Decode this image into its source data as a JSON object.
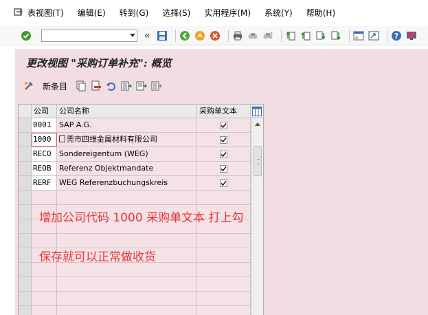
{
  "menubar": {
    "items": [
      "表视图(T)",
      "编辑(E)",
      "转到(G)",
      "选择(S)",
      "实用程序(M)",
      "系统(Y)",
      "帮助(H)"
    ]
  },
  "toolbar": {
    "command_field_value": "",
    "icons": [
      "enter-check-icon",
      "save-icon",
      "back-icon",
      "exit-icon",
      "cancel-icon",
      "print-icon",
      "find-icon",
      "find-next-icon",
      "first-page-icon",
      "previous-page-icon",
      "next-page-icon",
      "last-page-icon",
      "create-session-icon",
      "shortcut-icon",
      "help-icon",
      "layout-icon"
    ]
  },
  "title": "更改视图 \"采购订单补充\": 概览",
  "app_toolbar": {
    "new_entries_label": "新条目"
  },
  "table": {
    "columns": [
      "公司",
      "公司名称",
      "采购单文本"
    ],
    "rows": [
      {
        "code": "0001",
        "name": "SAP A.G.",
        "checked": true
      },
      {
        "code": "1000",
        "name": "莞市四维金属材料有限公司",
        "checked": true
      },
      {
        "code": "RECO",
        "name": "Sondereigentum (WEG)",
        "checked": true
      },
      {
        "code": "REOB",
        "name": "Referenz Objektmandate",
        "checked": true
      },
      {
        "code": "RERF",
        "name": "WEG Referenzbuchungskreis",
        "checked": true
      }
    ],
    "empty_rows": 9
  },
  "annotations": {
    "line1": "增加公司代码 1000   采购单文本 打上勾",
    "line2": "保存就可以正常做收货"
  },
  "colors": {
    "background_pink": "#f2dde2",
    "annotation_red": "#e8363a"
  }
}
